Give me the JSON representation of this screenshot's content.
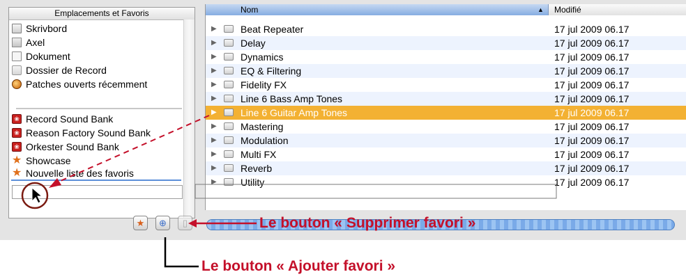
{
  "sidebar": {
    "header": "Emplacements et Favoris",
    "items": [
      {
        "label": "Skrivbord",
        "icon": "desktop-icon"
      },
      {
        "label": "Axel",
        "icon": "home-icon"
      },
      {
        "label": "Dokument",
        "icon": "document-icon"
      },
      {
        "label": "Dossier de Record",
        "icon": "folder-icon"
      },
      {
        "label": "Patches ouverts récemment",
        "icon": "recent-icon"
      },
      {
        "label": "Record Sound Bank",
        "icon": "soundbank-icon"
      },
      {
        "label": "Reason Factory Sound Bank",
        "icon": "soundbank-icon"
      },
      {
        "label": "Orkester Sound Bank",
        "icon": "soundbank-icon"
      },
      {
        "label": "Showcase",
        "icon": "star-icon"
      },
      {
        "label": "Nouvelle liste des favoris",
        "icon": "star-icon"
      }
    ]
  },
  "filelist": {
    "columns": {
      "name": "Nom",
      "modified": "Modifié"
    },
    "rows": [
      {
        "name": "Beat Repeater",
        "modified": "17 jul 2009 06.17"
      },
      {
        "name": "Delay",
        "modified": "17 jul 2009 06.17"
      },
      {
        "name": "Dynamics",
        "modified": "17 jul 2009 06.17"
      },
      {
        "name": "EQ & Filtering",
        "modified": "17 jul 2009 06.17"
      },
      {
        "name": "Fidelity FX",
        "modified": "17 jul 2009 06.17"
      },
      {
        "name": "Line 6 Bass Amp Tones",
        "modified": "17 jul 2009 06.17"
      },
      {
        "name": "Line 6 Guitar Amp Tones",
        "modified": "17 jul 2009 06.17",
        "selected": true
      },
      {
        "name": "Mastering",
        "modified": "17 jul 2009 06.17"
      },
      {
        "name": "Modulation",
        "modified": "17 jul 2009 06.17"
      },
      {
        "name": "Multi FX",
        "modified": "17 jul 2009 06.17"
      },
      {
        "name": "Reverb",
        "modified": "17 jul 2009 06.17"
      },
      {
        "name": "Utility",
        "modified": "17 jul 2009 06.17"
      }
    ]
  },
  "annotations": {
    "remove_favorite": "Le bouton « Supprimer favori »",
    "add_favorite": "Le bouton « Ajouter favori »"
  },
  "colors": {
    "selection": "#f3b133",
    "annotation": "#c4102a",
    "header_accent": "#86ade2",
    "star": "#e0701b",
    "soundbank": "#c9201e"
  }
}
